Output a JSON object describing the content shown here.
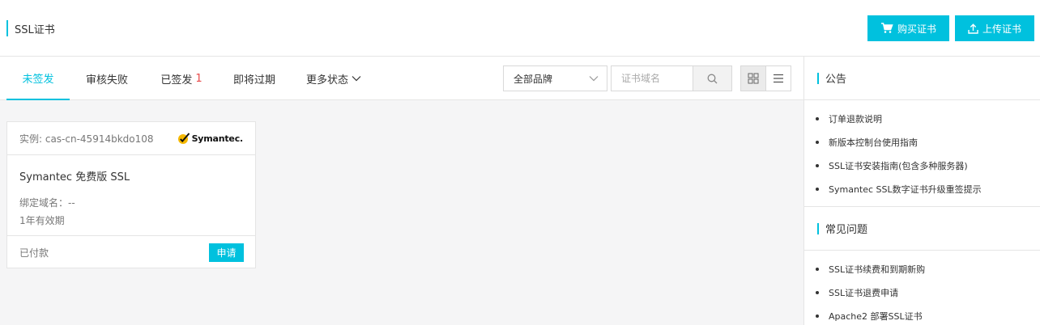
{
  "header": {
    "title": "SSL证书",
    "buy_label": "购买证书",
    "upload_label": "上传证书"
  },
  "tabs": [
    {
      "label": "未签发",
      "active": true
    },
    {
      "label": "审核失败"
    },
    {
      "label": "已签发",
      "count": "1"
    },
    {
      "label": "即将过期"
    },
    {
      "label": "更多状态"
    }
  ],
  "filters": {
    "brand_selected": "全部品牌",
    "search_placeholder": "证书域名"
  },
  "card": {
    "instance": "实例: cas-cn-45914bkdo108",
    "brand": "Symantec.",
    "product": "Symantec 免费版 SSL",
    "domain": "绑定域名：--",
    "validity": "1年有效期",
    "status": "已付款",
    "apply_label": "申请"
  },
  "sidebar": {
    "announcements_title": "公告",
    "announcements": [
      "订单退款说明",
      "新版本控制台使用指南",
      "SSL证书安装指南(包含多种服务器)",
      "Symantec SSL数字证书升级重签提示"
    ],
    "faq_title": "常见问题",
    "faq": [
      "SSL证书续费和到期新购",
      "SSL证书退费申请",
      "Apache2 部署SSL证书"
    ]
  },
  "colors": {
    "accent": "#00c1de",
    "count": "#e84a4a",
    "logo_check": "#f5b800"
  }
}
